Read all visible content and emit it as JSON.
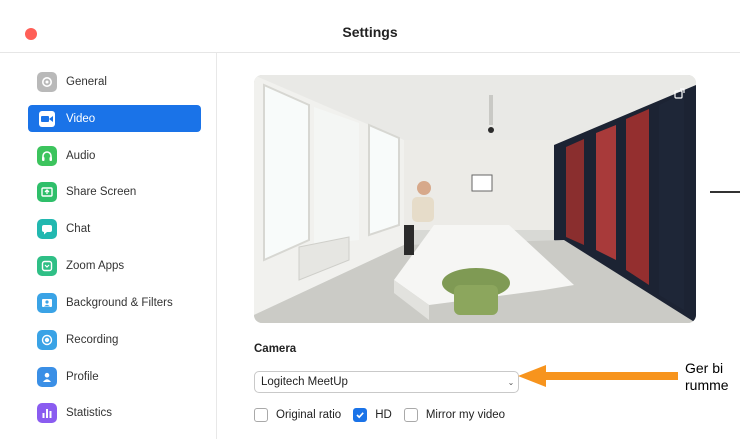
{
  "window": {
    "title": "Settings"
  },
  "sidebar": {
    "items": [
      {
        "label": "General",
        "icon": "gear-icon",
        "color": "#b9b9b9",
        "active": false
      },
      {
        "label": "Video",
        "icon": "video-camera-icon",
        "color": "#ffffff",
        "active": true
      },
      {
        "label": "Audio",
        "icon": "headphones-icon",
        "color": "#3cc45d",
        "active": false
      },
      {
        "label": "Share Screen",
        "icon": "share-screen-icon",
        "color": "#2fbf6a",
        "active": false
      },
      {
        "label": "Chat",
        "icon": "chat-icon",
        "color": "#22b8b0",
        "active": false
      },
      {
        "label": "Zoom Apps",
        "icon": "zoom-apps-icon",
        "color": "#2fbf86",
        "active": false
      },
      {
        "label": "Background & Filters",
        "icon": "background-icon",
        "color": "#3aa3e6",
        "active": false
      },
      {
        "label": "Recording",
        "icon": "recording-icon",
        "color": "#3aa3e6",
        "active": false
      },
      {
        "label": "Profile",
        "icon": "profile-icon",
        "color": "#3a8fe6",
        "active": false
      },
      {
        "label": "Statistics",
        "icon": "statistics-icon",
        "color": "#8a5cf0",
        "active": false
      }
    ],
    "active_color": "#1a73e8"
  },
  "video": {
    "camera_label": "Camera",
    "camera_selected": "Logitech MeetUp",
    "options": [
      {
        "label": "Original ratio",
        "checked": false
      },
      {
        "label": "HD",
        "checked": true
      },
      {
        "label": "Mirror my video",
        "checked": false
      }
    ]
  },
  "annotation": {
    "text_line1": "Ger bi",
    "text_line2": "rumme",
    "arrow_color": "#f7941d"
  }
}
